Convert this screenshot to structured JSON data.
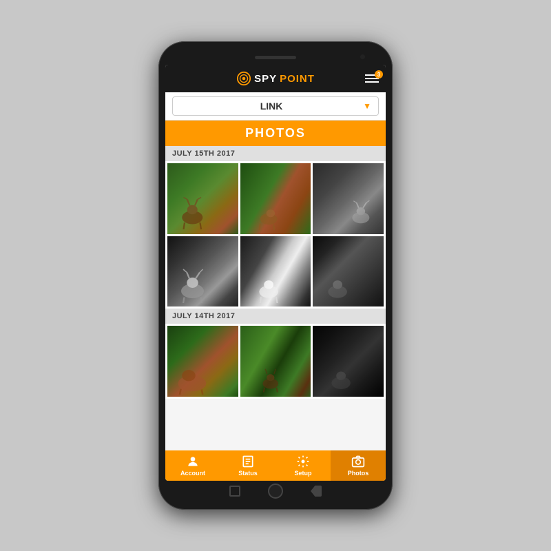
{
  "app": {
    "logo_spy": "SPY",
    "logo_point": "POINT",
    "menu_badge": "3",
    "device_name": "LINK",
    "photos_title": "PHOTOS",
    "dates": [
      {
        "label": "JULY 15TH 2017",
        "photos": [
          {
            "type": "deer-color-1"
          },
          {
            "type": "deer-color-2"
          },
          {
            "type": "deer-bw-1"
          },
          {
            "type": "deer-ir-1"
          },
          {
            "type": "deer-ir-2"
          },
          {
            "type": "deer-ir-3"
          }
        ]
      },
      {
        "label": "JULY 14TH 2017",
        "photos": [
          {
            "type": "deer-color-3"
          },
          {
            "type": "deer-color-4"
          },
          {
            "type": "deer-dark"
          }
        ]
      }
    ],
    "nav_items": [
      {
        "id": "account",
        "label": "Account",
        "active": false
      },
      {
        "id": "status",
        "label": "Status",
        "active": false
      },
      {
        "id": "setup",
        "label": "Setup",
        "active": false
      },
      {
        "id": "photos",
        "label": "Photos",
        "active": true
      }
    ]
  }
}
